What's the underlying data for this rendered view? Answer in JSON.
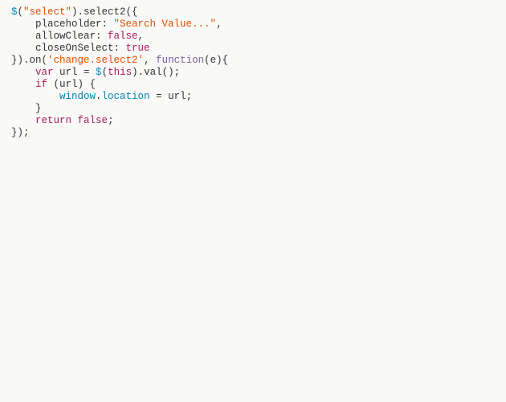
{
  "code": {
    "tokens": [
      [
        [
          "dollar",
          "$"
        ],
        [
          "punct",
          "("
        ],
        [
          "string",
          "\"select\""
        ],
        [
          "punct",
          ").select2({"
        ]
      ],
      [
        [
          "punct",
          "    placeholder: "
        ],
        [
          "string",
          "\"Search Value...\""
        ],
        [
          "punct",
          ","
        ]
      ],
      [
        [
          "punct",
          "    allowClear: "
        ],
        [
          "kw",
          "false"
        ],
        [
          "punct",
          ","
        ]
      ],
      [
        [
          "punct",
          "    closeOnSelect: "
        ],
        [
          "kw",
          "true"
        ]
      ],
      [
        [
          "punct",
          "}).on("
        ],
        [
          "string",
          "'change.select2'"
        ],
        [
          "punct",
          ", "
        ],
        [
          "func",
          "function"
        ],
        [
          "punct",
          "(e){"
        ]
      ],
      [
        [
          "punct",
          "    "
        ],
        [
          "kw",
          "var"
        ],
        [
          "punct",
          " url = "
        ],
        [
          "dollar",
          "$"
        ],
        [
          "punct",
          "("
        ],
        [
          "kw",
          "this"
        ],
        [
          "punct",
          ").val();"
        ]
      ],
      [
        [
          "punct",
          "    "
        ],
        [
          "kw",
          "if"
        ],
        [
          "punct",
          " (url) {"
        ]
      ],
      [
        [
          "punct",
          "        "
        ],
        [
          "prop",
          "window"
        ],
        [
          "punct",
          "."
        ],
        [
          "prop",
          "location"
        ],
        [
          "punct",
          " = url;"
        ]
      ],
      [
        [
          "punct",
          "    }"
        ]
      ],
      [
        [
          "punct",
          "    "
        ],
        [
          "kw",
          "return"
        ],
        [
          "punct",
          " "
        ],
        [
          "kw",
          "false"
        ],
        [
          "punct",
          ";"
        ]
      ],
      [
        [
          "punct",
          "});"
        ]
      ]
    ]
  }
}
